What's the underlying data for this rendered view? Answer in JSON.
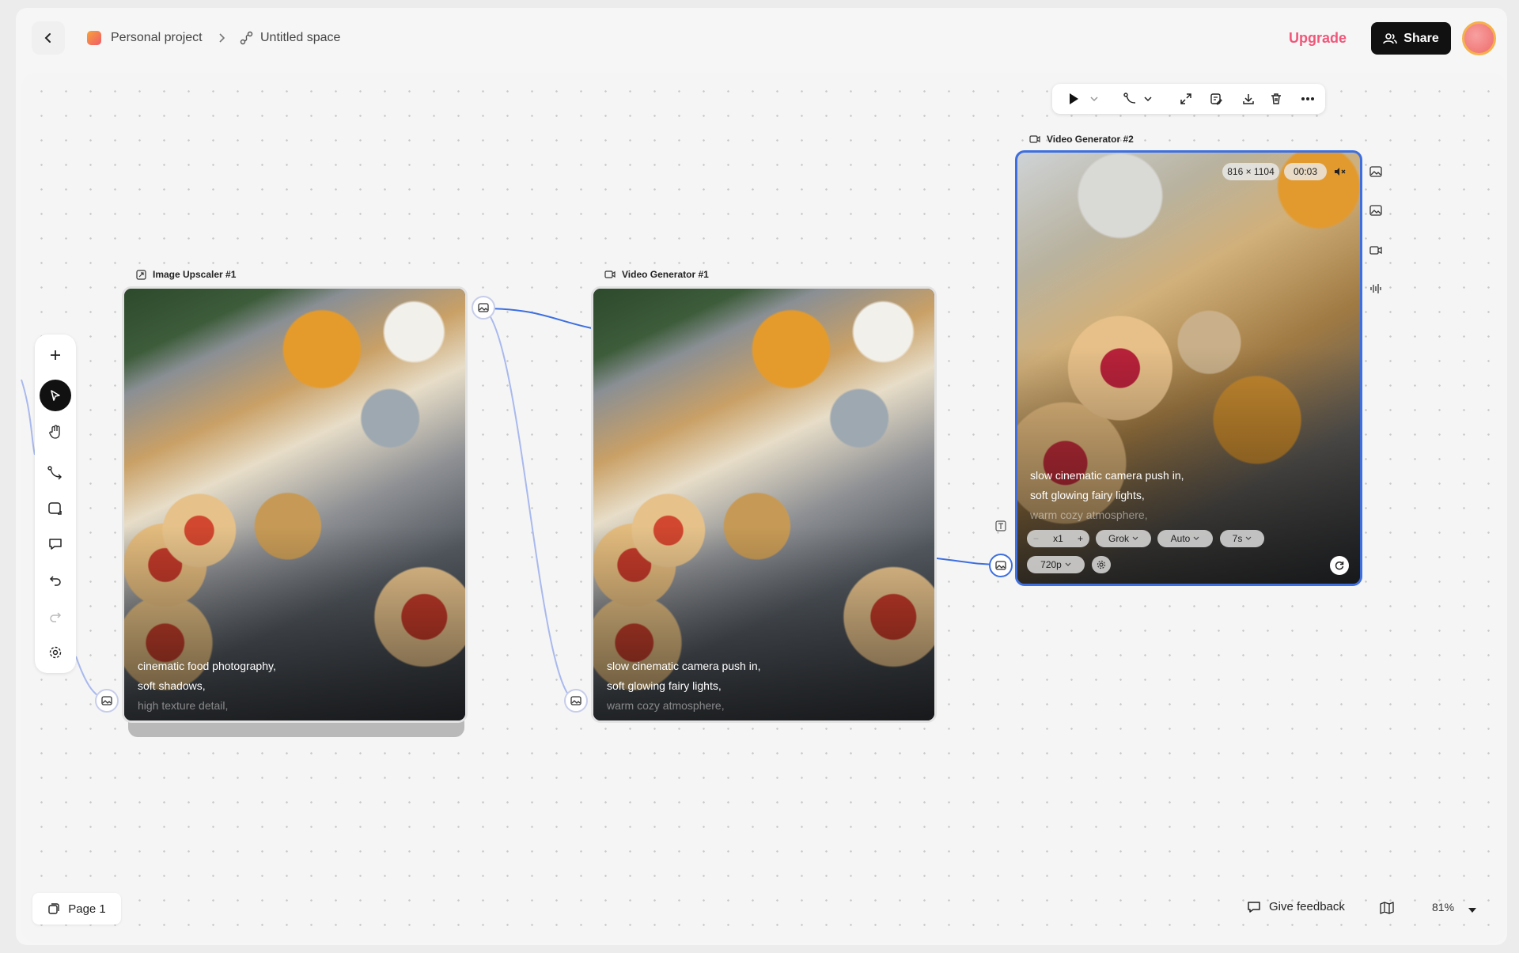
{
  "header": {
    "project_name": "Personal project",
    "space_name": "Untitled space",
    "upgrade_label": "Upgrade",
    "share_label": "Share"
  },
  "toolbar": {
    "items": [
      "plus-icon",
      "pointer-icon",
      "hand-icon",
      "connector-icon",
      "frame-icon",
      "comment-icon",
      "undo-icon",
      "redo-icon",
      "settings-icon"
    ],
    "active": "pointer-icon"
  },
  "nodes": [
    {
      "title": "Image Upscaler #1",
      "caption_lines": [
        "cinematic food photography,",
        "soft shadows,",
        "high texture detail,"
      ]
    },
    {
      "title": "Video Generator #1",
      "caption_lines": [
        "slow cinematic camera push in,",
        "soft glowing fairy lights,",
        "warm cozy atmosphere,"
      ]
    },
    {
      "title": "Video Generator #2",
      "dimensions": "816 × 1104",
      "duration": "00:03",
      "caption_lines": [
        "slow cinematic camera push in,",
        "soft glowing fairy lights,",
        "warm cozy atmosphere,"
      ],
      "count": "x1",
      "model": "Grok",
      "mode": "Auto",
      "length": "7s",
      "resolution": "720p"
    }
  ],
  "footer": {
    "page_label": "Page 1",
    "feedback_label": "Give feedback",
    "zoom": "81%"
  },
  "colors": {
    "accent_blue": "#3d6fe0",
    "upgrade_pink": "#f0577a",
    "edge_blue": "#9fb4ee"
  }
}
